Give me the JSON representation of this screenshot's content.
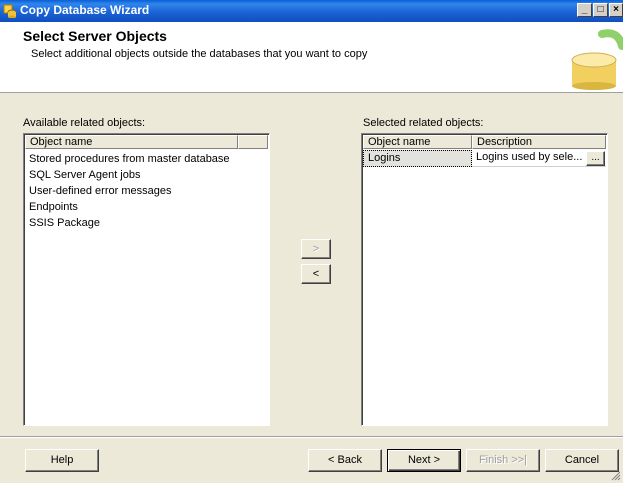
{
  "window": {
    "title": "Copy Database Wizard",
    "minimize_symbol": "_",
    "maximize_symbol": "□",
    "close_symbol": "×"
  },
  "header": {
    "title": "Select Server Objects",
    "subtitle": "Select additional objects outside the databases that you want to copy"
  },
  "available": {
    "label": "Available related objects:",
    "column_header": "Object name",
    "items": [
      "Stored procedures from master database",
      "SQL Server Agent jobs",
      "User-defined error messages",
      "Endpoints",
      "SSIS Package"
    ]
  },
  "move": {
    "add_label": ">",
    "remove_label": "<"
  },
  "selected": {
    "label": "Selected related objects:",
    "columns": [
      "Object name",
      "Description"
    ],
    "rows": [
      {
        "name": "Logins",
        "description": "Logins used by sele...",
        "ellipsis_label": "..."
      }
    ]
  },
  "footer": {
    "help": "Help",
    "back": "< Back",
    "next": "Next >",
    "finish": "Finish >>|",
    "cancel": "Cancel"
  },
  "colors": {
    "titlebar": "#0a5fd8",
    "dialog_bg": "#ece9d8",
    "header_bg": "#ffffff"
  }
}
